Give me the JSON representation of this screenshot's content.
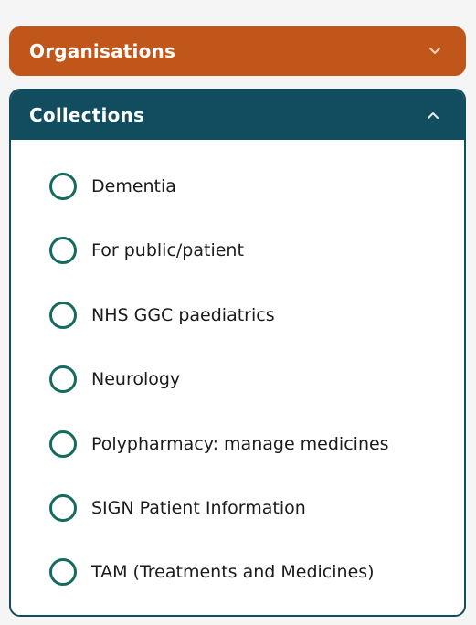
{
  "organisations": {
    "title": "Organisations",
    "chevron": "chevron-down-icon",
    "color": "#c1561a"
  },
  "collections": {
    "title": "Collections",
    "chevron": "chevron-up-icon",
    "color": "#124c5f",
    "radio_color": "#156b5d",
    "items": [
      {
        "label": "Dementia"
      },
      {
        "label": "For public/patient"
      },
      {
        "label": "NHS GGC paediatrics"
      },
      {
        "label": "Neurology"
      },
      {
        "label": "Polypharmacy: manage medicines"
      },
      {
        "label": "SIGN Patient Information"
      },
      {
        "label": "TAM (Treatments and Medicines)"
      }
    ]
  }
}
